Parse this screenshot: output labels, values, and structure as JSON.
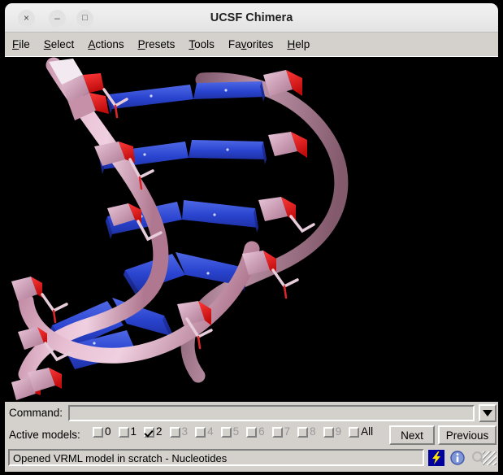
{
  "window": {
    "title": "UCSF Chimera",
    "close_label": "×",
    "minimize_label": "–",
    "maximize_label": "□"
  },
  "menubar": {
    "items": [
      {
        "label": "File",
        "accel_index": 0
      },
      {
        "label": "Select",
        "accel_index": 0
      },
      {
        "label": "Actions",
        "accel_index": 0
      },
      {
        "label": "Presets",
        "accel_index": 0
      },
      {
        "label": "Tools",
        "accel_index": 0
      },
      {
        "label": "Favorites",
        "accel_index": 2
      },
      {
        "label": "Help",
        "accel_index": 0
      }
    ]
  },
  "viewport": {
    "background_color": "#000000",
    "model_description": "DNA double helix, nucleotides representation",
    "colors": {
      "backbone": "#e0b4ca",
      "backbone_shadow": "#8d5f74",
      "base_slab": "#2a44cf",
      "base_slab_dark": "#1d2f9c",
      "base_slab_light": "#4a63e0",
      "oxygen_red": "#e21414",
      "highlight_white": "#f2eaf0",
      "sugar_pink": "#d79fbb"
    }
  },
  "command": {
    "label": "Command:",
    "value": "",
    "placeholder": "",
    "dropdown_icon": "chevron-down-icon"
  },
  "active_models": {
    "label": "Active models:",
    "checkboxes": [
      {
        "label": "0",
        "checked": false,
        "enabled": true
      },
      {
        "label": "1",
        "checked": false,
        "enabled": true
      },
      {
        "label": "2",
        "checked": true,
        "enabled": true
      },
      {
        "label": "3",
        "checked": false,
        "enabled": false
      },
      {
        "label": "4",
        "checked": false,
        "enabled": false
      },
      {
        "label": "5",
        "checked": false,
        "enabled": false
      },
      {
        "label": "6",
        "checked": false,
        "enabled": false
      },
      {
        "label": "7",
        "checked": false,
        "enabled": false
      },
      {
        "label": "8",
        "checked": false,
        "enabled": false
      },
      {
        "label": "9",
        "checked": false,
        "enabled": false
      },
      {
        "label": "All",
        "checked": false,
        "enabled": true
      }
    ],
    "next_label": "Next",
    "previous_label": "Previous"
  },
  "status": {
    "message": "Opened VRML model in scratch - Nucleotides",
    "icons": [
      {
        "name": "lightning-bolt-icon",
        "color": "#ffe600",
        "background": "#00009e"
      },
      {
        "name": "info-circle-icon",
        "color": "#4a63c8"
      },
      {
        "name": "magnifier-icon",
        "color": "#b0b0b0"
      }
    ],
    "resize_grip": "resize-grip"
  }
}
